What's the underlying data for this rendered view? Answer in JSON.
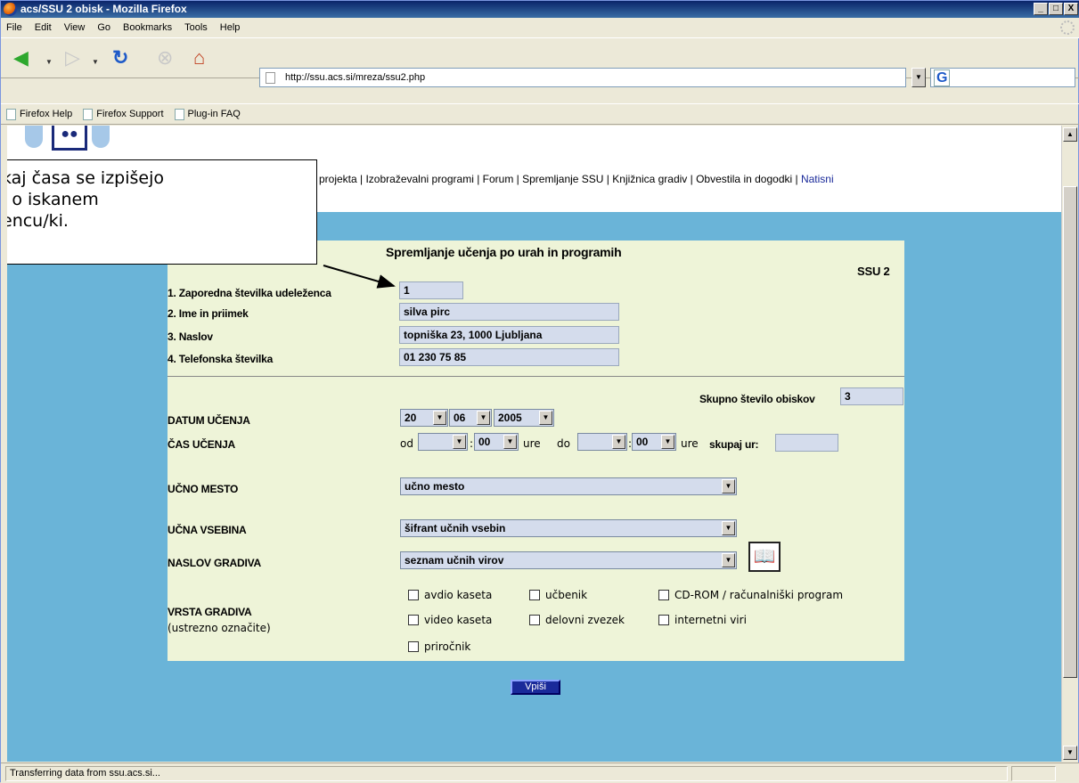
{
  "window": {
    "title": "acs/SSU 2 obisk - Mozilla Firefox",
    "btn_min": "_",
    "btn_max": "□",
    "btn_close": "X"
  },
  "menu": [
    "File",
    "Edit",
    "View",
    "Go",
    "Bookmarks",
    "Tools",
    "Help"
  ],
  "url": "http://ssu.acs.si/mreza/ssu2.php",
  "bookmarks": [
    "Firefox Help",
    "Firefox Support",
    "Plug-in FAQ"
  ],
  "site_nav": "projekta | Izobraževalni programi | Forum | Spremljanje SSU | Knjižnica gradiv | Obvestila in dogodki | ",
  "site_nav_highlight": "Natisni",
  "tooltip_lines": [
    "kaj časa se izpišejo",
    "i o iskanem",
    "encu/ki."
  ],
  "form": {
    "title": "Spremljanje učenja po urah in programih",
    "code": "SSU 2",
    "fields": [
      {
        "label": "1. Zaporedna številka udeleženca",
        "value": "1"
      },
      {
        "label": "2. Ime in priimek",
        "value": "silva pirc"
      },
      {
        "label": "3. Naslov",
        "value": "topniška 23, 1000 Ljubljana"
      },
      {
        "label": "4. Telefonska številka",
        "value": "01 230 75 85"
      }
    ],
    "visits_label": "Skupno število obiskov",
    "visits_value": "3",
    "date_label": "DATUM UČENJA",
    "date_day": "20",
    "date_month": "06",
    "date_year": "2005",
    "time_label": "ČAS UČENJA",
    "time_od": "od",
    "time_from_min": "00",
    "time_ure": "ure",
    "time_do": "do",
    "time_to_min": "00",
    "time_total": "skupaj ur:",
    "place_label": "UČNO MESTO",
    "place_value": "učno mesto",
    "content_label": "UČNA VSEBINA",
    "content_value": "šifrant učnih vsebin",
    "material_label": "NASLOV GRADIVA",
    "material_value": "seznam učnih virov",
    "type_label": "VRSTA GRADIVA",
    "type_hint": "(ustrezno označite)",
    "types": [
      "avdio kaseta",
      "učbenik",
      "CD-ROM / računalniški program",
      "video kaseta",
      "delovni zvezek",
      "internetni viri",
      "priročnik"
    ],
    "submit": "Vpiši"
  },
  "status": "Transferring data from ssu.acs.si..."
}
